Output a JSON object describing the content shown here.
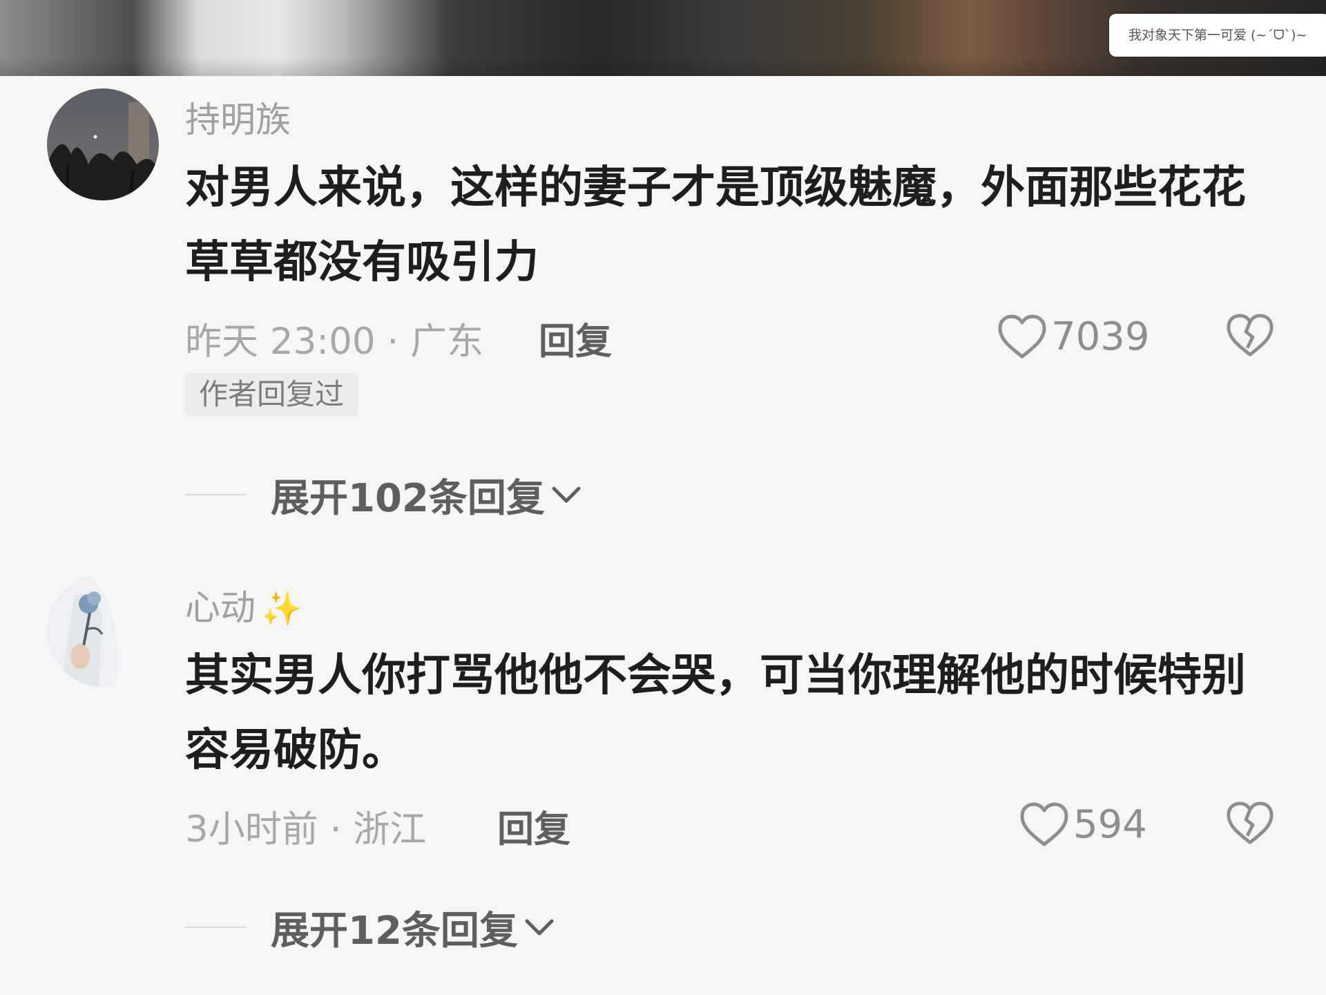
{
  "overlay": {
    "danmaku_text": "我对象天下第一可爱 (~ˊᗜˋ)~"
  },
  "comments": [
    {
      "username": "持明族",
      "text": "对男人来说，这样的妻子才是顶级魅魔，外面那些花花草草都没有吸引力",
      "time_location": "昨天 23:00 · 广东",
      "reply_label": "回复",
      "likes": "7039",
      "author_badge": "作者回复过",
      "expand_label": "展开102条回复",
      "avatar_icon": "night-sky-trees-avatar"
    },
    {
      "username": "心动",
      "username_emoji": "✨",
      "text": "其实男人你打骂他他不会哭，可当你理解他的时候特别容易破防。",
      "time_location": "3小时前 · 浙江",
      "reply_label": "回复",
      "likes": "594",
      "expand_label": "展开12条回复",
      "avatar_icon": "rose-hand-avatar"
    }
  ],
  "icons": {
    "like": "heart-outline-icon",
    "dislike": "broken-heart-icon",
    "expand": "chevron-down-icon"
  },
  "colors": {
    "background": "#f6f6f4",
    "text_primary": "#1e1e1e",
    "text_secondary": "#a0a0a0"
  }
}
